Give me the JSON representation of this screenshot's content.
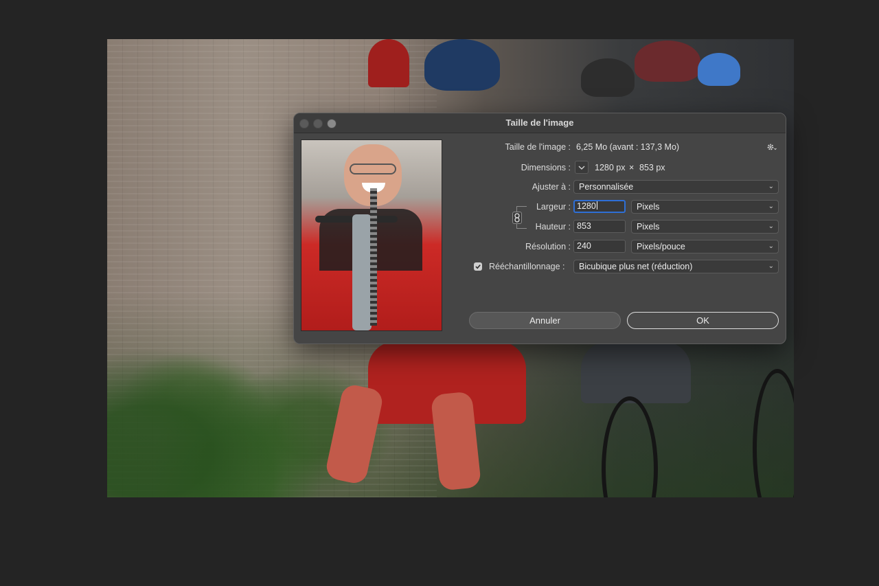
{
  "dialog": {
    "title": "Taille de l'image",
    "image_size_label": "Taille de l'image :",
    "image_size_value": "6,25 Mo (avant : 137,3 Mo)",
    "dimensions_label": "Dimensions :",
    "dimensions_width": "1280 px",
    "dimensions_times": "×",
    "dimensions_height": "853 px",
    "fit_label": "Ajuster à :",
    "fit_value": "Personnalisée",
    "width_label": "Largeur :",
    "width_value": "1280",
    "width_unit": "Pixels",
    "height_label": "Hauteur :",
    "height_value": "853",
    "height_unit": "Pixels",
    "resolution_label": "Résolution :",
    "resolution_value": "240",
    "resolution_unit": "Pixels/pouce",
    "resample_label": "Rééchantillonnage :",
    "resample_checked": true,
    "resample_value": "Bicubique plus net (réduction)",
    "cancel_label": "Annuler",
    "ok_label": "OK"
  },
  "icons": {
    "settings": "gear-icon",
    "constrain": "chain-link-icon",
    "dimensions_toggle": "chevron-down-icon",
    "dropdown": "chevron-down-icon",
    "checkbox": "checkmark-icon"
  },
  "colors": {
    "app_background": "#242424",
    "dialog_background": "#454545",
    "focus_ring": "#2e6fd6"
  }
}
